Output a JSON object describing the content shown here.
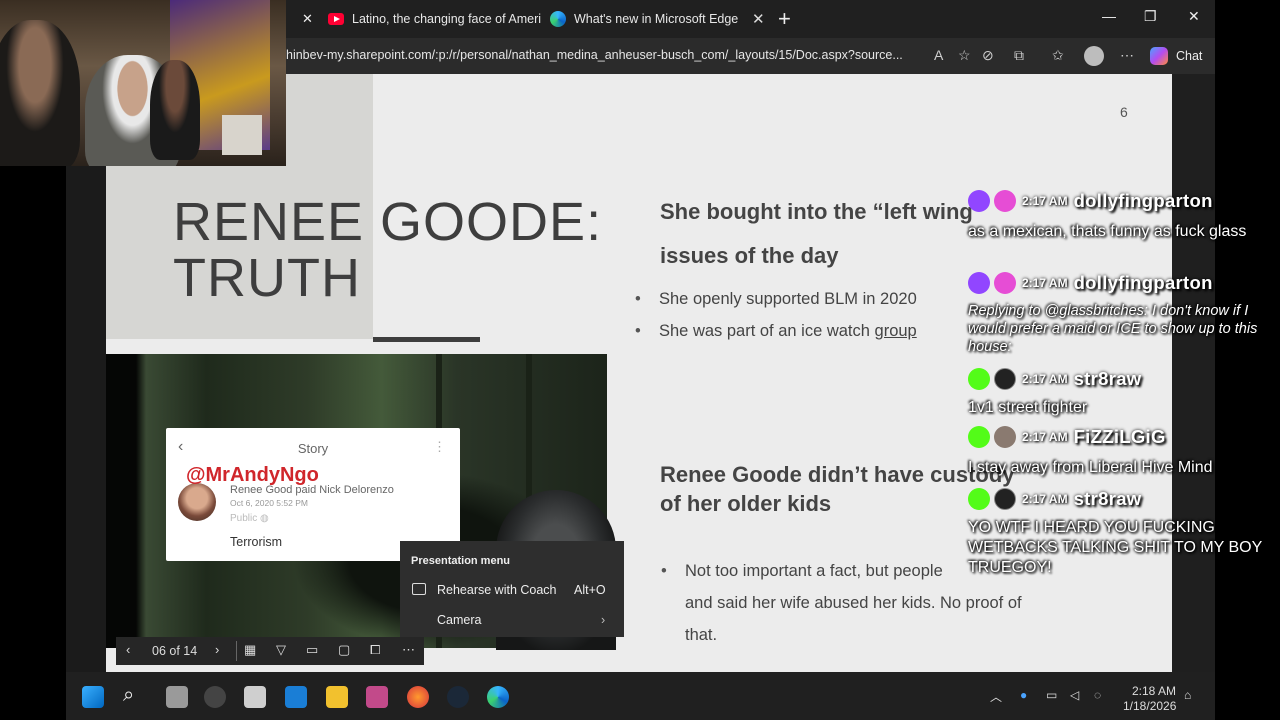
{
  "browser": {
    "tabs": [
      {
        "label": "Latino, the changing face of Ameri",
        "favicon": "youtube-icon"
      },
      {
        "label": "What's new in Microsoft Edge",
        "favicon": "edge-icon"
      }
    ],
    "new_tab": "+",
    "url": "hinbev-my.sharepoint.com/:p:/r/personal/nathan_medina_anheuser-busch_com/_layouts/15/Doc.aspx?source...",
    "chat_label": "Chat",
    "win_minimize": "—",
    "win_restore": "❐",
    "win_close": "✕",
    "tab_close": "✕"
  },
  "slide": {
    "page_number": "6",
    "title_line1": "RENEE GOODE:",
    "title_line2": "TRUTH",
    "section1": {
      "heading_line1": "She bought into the “left wing",
      "heading_line2": "issues of the day",
      "bullet1": "She openly supported BLM in 2020",
      "bullet2_prefix": "She was part of an ice watch ",
      "bullet2_link": "group"
    },
    "section2": {
      "heading_line1": "Renee Goode didn’t have custody",
      "heading_line2": "of her older kids",
      "bullet_line1": "Not too important a fact, but people",
      "bullet_line2": "and said her wife abused her kids. No proof of",
      "bullet_line3": "that."
    },
    "story": {
      "title": "Story",
      "handle": "@MrAndyNgo",
      "subline": "Renee Good paid Nick Delorenzo",
      "date": "Oct 6, 2020 5:52 PM",
      "visibility": "Public",
      "word": "Terrorism"
    }
  },
  "presentation_menu": {
    "header": "Presentation menu",
    "items": [
      {
        "label": "Rehearse with Coach",
        "shortcut": "Alt+O"
      },
      {
        "label": "Camera"
      }
    ]
  },
  "slide_toolbar": {
    "counter": "06 of 14"
  },
  "chat": {
    "messages": [
      {
        "time": "2:17 AM",
        "user": "dollyfingparton",
        "text": "as a mexican, thats funny as fuck glass",
        "italic": false
      },
      {
        "time": "2:17 AM",
        "user": "dollyfingparton",
        "text": "Replying to @glassbritches: I don't know if I would prefer a maid or ICE to show up to this house:",
        "italic": true
      },
      {
        "time": "2:17 AM",
        "user": "str8raw",
        "text": "1v1 street fighter",
        "italic": false
      },
      {
        "time": "2:17 AM",
        "user": "FiZZiLGiG",
        "text": "I stay away from Liberal Hive Mind",
        "italic": false
      },
      {
        "time": "2:17 AM",
        "user": "str8raw",
        "text": "YO WTF I HEARD YOU FUCKING WETBACKS TALKING SHIT TO MY BOY TRUEGOY!",
        "italic": false
      }
    ]
  },
  "taskbar": {
    "time": "2:18 AM",
    "date": "1/18/2026"
  },
  "colors": {
    "slide_bg": "#ececec",
    "title_panel": "#d6d6d3",
    "twitch_purple": "#9146ff",
    "kick_green": "#53fc18",
    "handle_red": "#d0262b"
  }
}
